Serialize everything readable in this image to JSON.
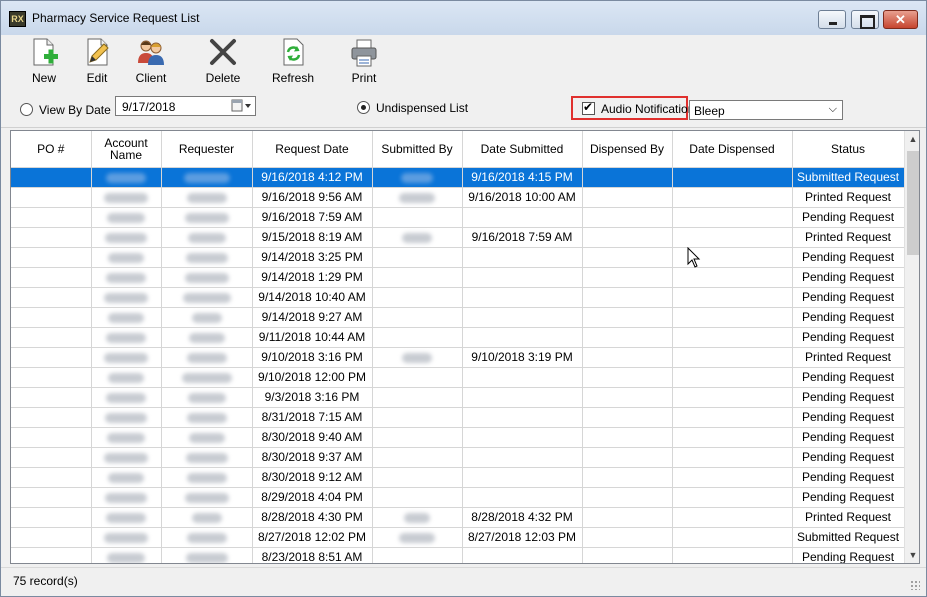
{
  "window": {
    "title": "Pharmacy Service Request List",
    "icon_text": "RX"
  },
  "toolbar": [
    {
      "id": "new",
      "label": "New",
      "icon": "new-doc-plus-icon"
    },
    {
      "id": "edit",
      "label": "Edit",
      "icon": "edit-doc-pencil-icon"
    },
    {
      "id": "client",
      "label": "Client",
      "icon": "client-people-icon"
    },
    {
      "id": "delete",
      "label": "Delete",
      "icon": "delete-x-icon"
    },
    {
      "id": "refresh",
      "label": "Refresh",
      "icon": "refresh-icon"
    },
    {
      "id": "print",
      "label": "Print",
      "icon": "printer-icon"
    }
  ],
  "filters": {
    "view_by_date_label": "View By Date",
    "view_by_date_selected": false,
    "date_value": "9/17/2018",
    "undispensed_label": "Undispensed List",
    "undispensed_selected": true,
    "audio_notification_label": "Audio Notification",
    "audio_notification_checked": true,
    "sound_value": "Bleep"
  },
  "colors": {
    "selection": "#0a74d8",
    "highlight_border": "#e0302e"
  },
  "table": {
    "columns": [
      "PO #",
      "Account Name",
      "Requester",
      "Request Date",
      "Submitted By",
      "Date Submitted",
      "Dispensed By",
      "Date Dispensed",
      "Status"
    ],
    "rows": [
      {
        "po": "",
        "request_date": "9/16/2018 4:12 PM",
        "date_submitted": "9/16/2018 4:15 PM",
        "dispensed_by": "",
        "date_dispensed": "",
        "status": "Submitted Request",
        "submitted_blurred": true,
        "selected": true
      },
      {
        "po": "",
        "request_date": "9/16/2018 9:56 AM",
        "date_submitted": "9/16/2018 10:00 AM",
        "dispensed_by": "",
        "date_dispensed": "",
        "status": "Printed Request",
        "submitted_blurred": true,
        "selected": false
      },
      {
        "po": "",
        "request_date": "9/16/2018 7:59 AM",
        "date_submitted": "",
        "dispensed_by": "",
        "date_dispensed": "",
        "status": "Pending Request",
        "submitted_blurred": false,
        "selected": false
      },
      {
        "po": "",
        "request_date": "9/15/2018 8:19 AM",
        "date_submitted": "9/16/2018 7:59 AM",
        "dispensed_by": "",
        "date_dispensed": "",
        "status": "Printed Request",
        "submitted_blurred": true,
        "selected": false
      },
      {
        "po": "",
        "request_date": "9/14/2018 3:25 PM",
        "date_submitted": "",
        "dispensed_by": "",
        "date_dispensed": "",
        "status": "Pending Request",
        "submitted_blurred": false,
        "selected": false
      },
      {
        "po": "",
        "request_date": "9/14/2018 1:29 PM",
        "date_submitted": "",
        "dispensed_by": "",
        "date_dispensed": "",
        "status": "Pending Request",
        "submitted_blurred": false,
        "selected": false
      },
      {
        "po": "",
        "request_date": "9/14/2018 10:40 AM",
        "date_submitted": "",
        "dispensed_by": "",
        "date_dispensed": "",
        "status": "Pending Request",
        "submitted_blurred": false,
        "selected": false
      },
      {
        "po": "",
        "request_date": "9/14/2018 9:27 AM",
        "date_submitted": "",
        "dispensed_by": "",
        "date_dispensed": "",
        "status": "Pending Request",
        "submitted_blurred": false,
        "selected": false
      },
      {
        "po": "",
        "request_date": "9/11/2018 10:44 AM",
        "date_submitted": "",
        "dispensed_by": "",
        "date_dispensed": "",
        "status": "Pending Request",
        "submitted_blurred": false,
        "selected": false
      },
      {
        "po": "",
        "request_date": "9/10/2018 3:16 PM",
        "date_submitted": "9/10/2018 3:19 PM",
        "dispensed_by": "",
        "date_dispensed": "",
        "status": "Printed Request",
        "submitted_blurred": true,
        "selected": false
      },
      {
        "po": "",
        "request_date": "9/10/2018 12:00 PM",
        "date_submitted": "",
        "dispensed_by": "",
        "date_dispensed": "",
        "status": "Pending Request",
        "submitted_blurred": false,
        "selected": false
      },
      {
        "po": "",
        "request_date": "9/3/2018 3:16 PM",
        "date_submitted": "",
        "dispensed_by": "",
        "date_dispensed": "",
        "status": "Pending Request",
        "submitted_blurred": false,
        "selected": false
      },
      {
        "po": "",
        "request_date": "8/31/2018 7:15 AM",
        "date_submitted": "",
        "dispensed_by": "",
        "date_dispensed": "",
        "status": "Pending Request",
        "submitted_blurred": false,
        "selected": false
      },
      {
        "po": "",
        "request_date": "8/30/2018 9:40 AM",
        "date_submitted": "",
        "dispensed_by": "",
        "date_dispensed": "",
        "status": "Pending Request",
        "submitted_blurred": false,
        "selected": false
      },
      {
        "po": "",
        "request_date": "8/30/2018 9:37 AM",
        "date_submitted": "",
        "dispensed_by": "",
        "date_dispensed": "",
        "status": "Pending Request",
        "submitted_blurred": false,
        "selected": false
      },
      {
        "po": "",
        "request_date": "8/30/2018 9:12 AM",
        "date_submitted": "",
        "dispensed_by": "",
        "date_dispensed": "",
        "status": "Pending Request",
        "submitted_blurred": false,
        "selected": false
      },
      {
        "po": "",
        "request_date": "8/29/2018 4:04 PM",
        "date_submitted": "",
        "dispensed_by": "",
        "date_dispensed": "",
        "status": "Pending Request",
        "submitted_blurred": false,
        "selected": false
      },
      {
        "po": "",
        "request_date": "8/28/2018 4:30 PM",
        "date_submitted": "8/28/2018 4:32 PM",
        "dispensed_by": "",
        "date_dispensed": "",
        "status": "Printed Request",
        "submitted_blurred": true,
        "selected": false
      },
      {
        "po": "",
        "request_date": "8/27/2018 12:02 PM",
        "date_submitted": "8/27/2018 12:03 PM",
        "dispensed_by": "",
        "date_dispensed": "",
        "status": "Submitted Request",
        "submitted_blurred": true,
        "selected": false
      },
      {
        "po": "",
        "request_date": "8/23/2018 8:51 AM",
        "date_submitted": "",
        "dispensed_by": "",
        "date_dispensed": "",
        "status": "Pending Request",
        "submitted_blurred": false,
        "selected": false
      }
    ]
  },
  "status_bar": {
    "record_count": "75 record(s)"
  }
}
